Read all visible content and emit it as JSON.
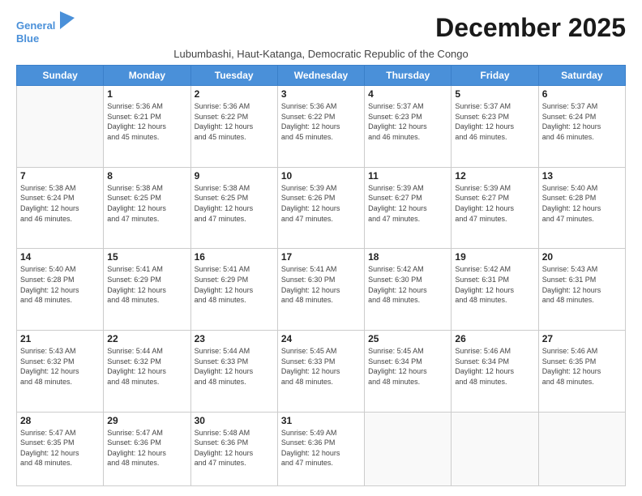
{
  "logo": {
    "line1": "General",
    "line2": "Blue"
  },
  "title": "December 2025",
  "subtitle": "Lubumbashi, Haut-Katanga, Democratic Republic of the Congo",
  "days_of_week": [
    "Sunday",
    "Monday",
    "Tuesday",
    "Wednesday",
    "Thursday",
    "Friday",
    "Saturday"
  ],
  "weeks": [
    [
      {
        "day": "",
        "info": ""
      },
      {
        "day": "1",
        "info": "Sunrise: 5:36 AM\nSunset: 6:21 PM\nDaylight: 12 hours\nand 45 minutes."
      },
      {
        "day": "2",
        "info": "Sunrise: 5:36 AM\nSunset: 6:22 PM\nDaylight: 12 hours\nand 45 minutes."
      },
      {
        "day": "3",
        "info": "Sunrise: 5:36 AM\nSunset: 6:22 PM\nDaylight: 12 hours\nand 45 minutes."
      },
      {
        "day": "4",
        "info": "Sunrise: 5:37 AM\nSunset: 6:23 PM\nDaylight: 12 hours\nand 46 minutes."
      },
      {
        "day": "5",
        "info": "Sunrise: 5:37 AM\nSunset: 6:23 PM\nDaylight: 12 hours\nand 46 minutes."
      },
      {
        "day": "6",
        "info": "Sunrise: 5:37 AM\nSunset: 6:24 PM\nDaylight: 12 hours\nand 46 minutes."
      }
    ],
    [
      {
        "day": "7",
        "info": "Sunrise: 5:38 AM\nSunset: 6:24 PM\nDaylight: 12 hours\nand 46 minutes."
      },
      {
        "day": "8",
        "info": "Sunrise: 5:38 AM\nSunset: 6:25 PM\nDaylight: 12 hours\nand 47 minutes."
      },
      {
        "day": "9",
        "info": "Sunrise: 5:38 AM\nSunset: 6:25 PM\nDaylight: 12 hours\nand 47 minutes."
      },
      {
        "day": "10",
        "info": "Sunrise: 5:39 AM\nSunset: 6:26 PM\nDaylight: 12 hours\nand 47 minutes."
      },
      {
        "day": "11",
        "info": "Sunrise: 5:39 AM\nSunset: 6:27 PM\nDaylight: 12 hours\nand 47 minutes."
      },
      {
        "day": "12",
        "info": "Sunrise: 5:39 AM\nSunset: 6:27 PM\nDaylight: 12 hours\nand 47 minutes."
      },
      {
        "day": "13",
        "info": "Sunrise: 5:40 AM\nSunset: 6:28 PM\nDaylight: 12 hours\nand 47 minutes."
      }
    ],
    [
      {
        "day": "14",
        "info": "Sunrise: 5:40 AM\nSunset: 6:28 PM\nDaylight: 12 hours\nand 48 minutes."
      },
      {
        "day": "15",
        "info": "Sunrise: 5:41 AM\nSunset: 6:29 PM\nDaylight: 12 hours\nand 48 minutes."
      },
      {
        "day": "16",
        "info": "Sunrise: 5:41 AM\nSunset: 6:29 PM\nDaylight: 12 hours\nand 48 minutes."
      },
      {
        "day": "17",
        "info": "Sunrise: 5:41 AM\nSunset: 6:30 PM\nDaylight: 12 hours\nand 48 minutes."
      },
      {
        "day": "18",
        "info": "Sunrise: 5:42 AM\nSunset: 6:30 PM\nDaylight: 12 hours\nand 48 minutes."
      },
      {
        "day": "19",
        "info": "Sunrise: 5:42 AM\nSunset: 6:31 PM\nDaylight: 12 hours\nand 48 minutes."
      },
      {
        "day": "20",
        "info": "Sunrise: 5:43 AM\nSunset: 6:31 PM\nDaylight: 12 hours\nand 48 minutes."
      }
    ],
    [
      {
        "day": "21",
        "info": "Sunrise: 5:43 AM\nSunset: 6:32 PM\nDaylight: 12 hours\nand 48 minutes."
      },
      {
        "day": "22",
        "info": "Sunrise: 5:44 AM\nSunset: 6:32 PM\nDaylight: 12 hours\nand 48 minutes."
      },
      {
        "day": "23",
        "info": "Sunrise: 5:44 AM\nSunset: 6:33 PM\nDaylight: 12 hours\nand 48 minutes."
      },
      {
        "day": "24",
        "info": "Sunrise: 5:45 AM\nSunset: 6:33 PM\nDaylight: 12 hours\nand 48 minutes."
      },
      {
        "day": "25",
        "info": "Sunrise: 5:45 AM\nSunset: 6:34 PM\nDaylight: 12 hours\nand 48 minutes."
      },
      {
        "day": "26",
        "info": "Sunrise: 5:46 AM\nSunset: 6:34 PM\nDaylight: 12 hours\nand 48 minutes."
      },
      {
        "day": "27",
        "info": "Sunrise: 5:46 AM\nSunset: 6:35 PM\nDaylight: 12 hours\nand 48 minutes."
      }
    ],
    [
      {
        "day": "28",
        "info": "Sunrise: 5:47 AM\nSunset: 6:35 PM\nDaylight: 12 hours\nand 48 minutes."
      },
      {
        "day": "29",
        "info": "Sunrise: 5:47 AM\nSunset: 6:36 PM\nDaylight: 12 hours\nand 48 minutes."
      },
      {
        "day": "30",
        "info": "Sunrise: 5:48 AM\nSunset: 6:36 PM\nDaylight: 12 hours\nand 47 minutes."
      },
      {
        "day": "31",
        "info": "Sunrise: 5:49 AM\nSunset: 6:36 PM\nDaylight: 12 hours\nand 47 minutes."
      },
      {
        "day": "",
        "info": ""
      },
      {
        "day": "",
        "info": ""
      },
      {
        "day": "",
        "info": ""
      }
    ]
  ]
}
